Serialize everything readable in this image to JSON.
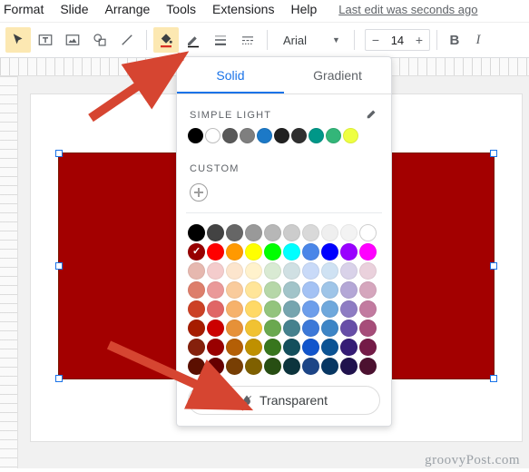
{
  "menubar": {
    "items": [
      "Format",
      "Slide",
      "Arrange",
      "Tools",
      "Extensions",
      "Help"
    ],
    "edit_status": "Last edit was seconds ago"
  },
  "toolbar": {
    "font_name": "Arial",
    "font_size": "14"
  },
  "shape": {
    "fill_color": "#a30000"
  },
  "picker": {
    "tabs": {
      "solid": "Solid",
      "gradient": "Gradient",
      "active": "solid"
    },
    "theme_title": "SIMPLE LIGHT",
    "theme_colors": [
      "#000000",
      "#ffffff",
      "#595959",
      "#7f7f7f",
      "#1c79c7",
      "#212121",
      "#303030",
      "#009788",
      "#33b679",
      "#eeff41"
    ],
    "custom_title": "CUSTOM",
    "transparent_label": "Transparent",
    "grid_rows": [
      [
        "#000000",
        "#434343",
        "#666666",
        "#999999",
        "#b7b7b7",
        "#cccccc",
        "#d9d9d9",
        "#efefef",
        "#f3f3f3",
        "#ffffff"
      ],
      [
        "#980000",
        "#ff0000",
        "#ff9900",
        "#ffff00",
        "#00ff00",
        "#00ffff",
        "#4a86e8",
        "#0000ff",
        "#9900ff",
        "#ff00ff"
      ],
      [
        "#e6b8af",
        "#f4cccc",
        "#fce5cd",
        "#fff2cc",
        "#d9ead3",
        "#d0e0e3",
        "#c9daf8",
        "#cfe2f3",
        "#d9d2e9",
        "#ead1dc"
      ],
      [
        "#dd7e6b",
        "#ea9999",
        "#f9cb9c",
        "#ffe599",
        "#b6d7a8",
        "#a2c4c9",
        "#a4c2f4",
        "#9fc5e8",
        "#b4a7d6",
        "#d5a6bd"
      ],
      [
        "#cc4125",
        "#e06666",
        "#f6b26b",
        "#ffd966",
        "#93c47d",
        "#76a5af",
        "#6d9eeb",
        "#6fa8dc",
        "#8e7cc3",
        "#c27ba0"
      ],
      [
        "#a61c00",
        "#cc0000",
        "#e69138",
        "#f1c232",
        "#6aa84f",
        "#45818e",
        "#3c78d8",
        "#3d85c6",
        "#674ea7",
        "#a64d79"
      ],
      [
        "#85200c",
        "#990000",
        "#b45f06",
        "#bf9000",
        "#38761d",
        "#134f5c",
        "#1155cc",
        "#0b5394",
        "#351c75",
        "#741b47"
      ],
      [
        "#5b0f00",
        "#660000",
        "#783f04",
        "#7f6000",
        "#274e13",
        "#0c343d",
        "#1c4587",
        "#073763",
        "#20124d",
        "#4c1130"
      ]
    ],
    "selected_color": "#980000"
  },
  "watermark": "groovyPost.com"
}
